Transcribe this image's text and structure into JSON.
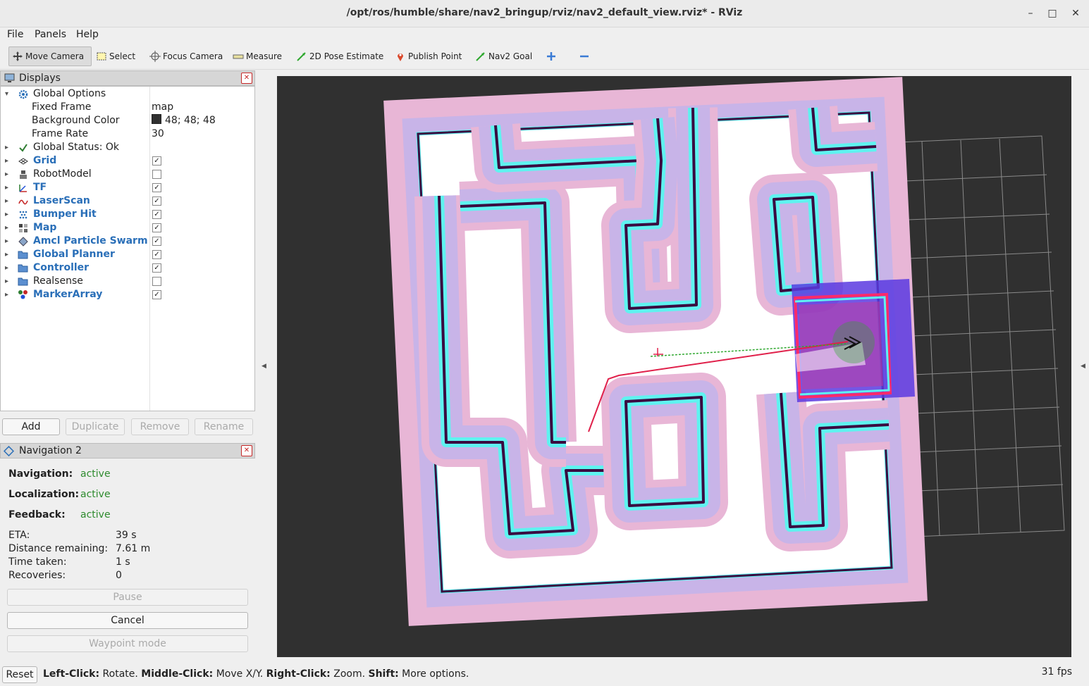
{
  "window": {
    "title": "/opt/ros/humble/share/nav2_bringup/rviz/nav2_default_view.rviz* - RViz",
    "minimize": "–",
    "maximize": "□",
    "close": "✕"
  },
  "menu": {
    "file": "File",
    "panels": "Panels",
    "help": "Help"
  },
  "toolbar": {
    "move_camera": "Move Camera",
    "select": "Select",
    "focus_camera": "Focus Camera",
    "measure": "Measure",
    "pose_estimate": "2D Pose Estimate",
    "publish_point": "Publish Point",
    "nav2_goal": "Nav2 Goal"
  },
  "displays": {
    "header": "Displays",
    "global_options": "Global Options",
    "fixed_frame_label": "Fixed Frame",
    "fixed_frame_value": "map",
    "bg_color_label": "Background Color",
    "bg_color_value": "48; 48; 48",
    "frame_rate_label": "Frame Rate",
    "frame_rate_value": "30",
    "global_status": "Global Status: Ok",
    "items": [
      {
        "name": "Grid",
        "checked": true,
        "icon": "grid-icon",
        "color": "blue"
      },
      {
        "name": "RobotModel",
        "checked": false,
        "icon": "robot-icon",
        "color": "black"
      },
      {
        "name": "TF",
        "checked": true,
        "icon": "tf-icon",
        "color": "blue"
      },
      {
        "name": "LaserScan",
        "checked": true,
        "icon": "laserscan-icon",
        "color": "blue"
      },
      {
        "name": "Bumper Hit",
        "checked": true,
        "icon": "bumper-icon",
        "color": "blue"
      },
      {
        "name": "Map",
        "checked": true,
        "icon": "map-icon",
        "color": "blue"
      },
      {
        "name": "Amcl Particle Swarm",
        "checked": true,
        "icon": "particle-icon",
        "color": "blue"
      },
      {
        "name": "Global Planner",
        "checked": true,
        "icon": "folder-icon",
        "color": "blue"
      },
      {
        "name": "Controller",
        "checked": true,
        "icon": "folder-icon",
        "color": "blue"
      },
      {
        "name": "Realsense",
        "checked": false,
        "icon": "folder-icon",
        "color": "black"
      },
      {
        "name": "MarkerArray",
        "checked": true,
        "icon": "marker-icon",
        "color": "blue"
      }
    ],
    "buttons": {
      "add": "Add",
      "duplicate": "Duplicate",
      "remove": "Remove",
      "rename": "Rename"
    }
  },
  "navigation": {
    "header": "Navigation 2",
    "navigation_label": "Navigation:",
    "navigation_value": "active",
    "localization_label": "Localization:",
    "localization_value": "active",
    "feedback_label": "Feedback:",
    "feedback_value": "active",
    "eta_label": "ETA:",
    "eta_value": "39 s",
    "distance_label": "Distance remaining:",
    "distance_value": "7.61 m",
    "time_label": "Time taken:",
    "time_value": "1 s",
    "recoveries_label": "Recoveries:",
    "recoveries_value": "0",
    "pause": "Pause",
    "cancel": "Cancel",
    "waypoint": "Waypoint mode"
  },
  "status": {
    "reset": "Reset",
    "left_click_key": "Left-Click:",
    "left_click_val": " Rotate. ",
    "middle_click_key": "Middle-Click:",
    "middle_click_val": " Move X/Y. ",
    "right_click_key": "Right-Click:",
    "right_click_val": " Zoom. ",
    "shift_key": "Shift:",
    "shift_val": " More options.",
    "fps": "31 fps"
  },
  "colors": {
    "viewport_bg": "#303030",
    "costmap_pink": "#e8b6d6",
    "costmap_lavender": "#c8b4e8",
    "inflation_cyan": "#5ff3f0",
    "wall": "#3a0a40",
    "path": "#e0204a",
    "local_costmap": "#5a3ae0",
    "active_green": "#2e8b2e"
  }
}
